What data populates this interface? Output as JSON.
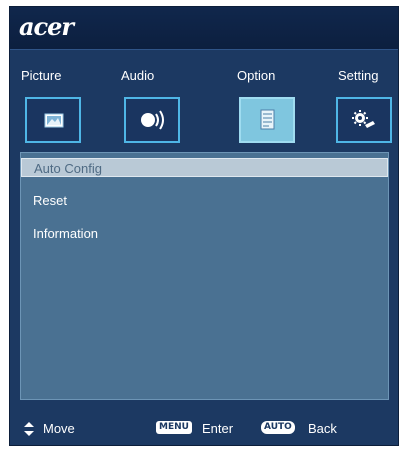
{
  "brand": {
    "logo_text": "acer"
  },
  "tabs": [
    {
      "label": "Picture",
      "icon": "picture-icon",
      "active": false
    },
    {
      "label": "Audio",
      "icon": "speaker-icon",
      "active": false
    },
    {
      "label": "Option",
      "icon": "checklist-icon",
      "active": true
    },
    {
      "label": "Setting",
      "icon": "gear-wrench-icon",
      "active": false
    }
  ],
  "menu": {
    "items": [
      {
        "label": "Auto Config",
        "selected": true
      },
      {
        "label": "Reset",
        "selected": false
      },
      {
        "label": "Information",
        "selected": false
      }
    ]
  },
  "footer": {
    "move_label": "Move",
    "menu_key": "MENU",
    "enter_label": "Enter",
    "auto_key": "AUTO",
    "back_label": "Back"
  },
  "colors": {
    "panel_bg": "#1c3962",
    "content_bg": "#4a7192",
    "tab_border": "#4fb6e6",
    "active_tab_bg": "#7fc6df",
    "selected_item_bg": "#b9c9d6"
  }
}
